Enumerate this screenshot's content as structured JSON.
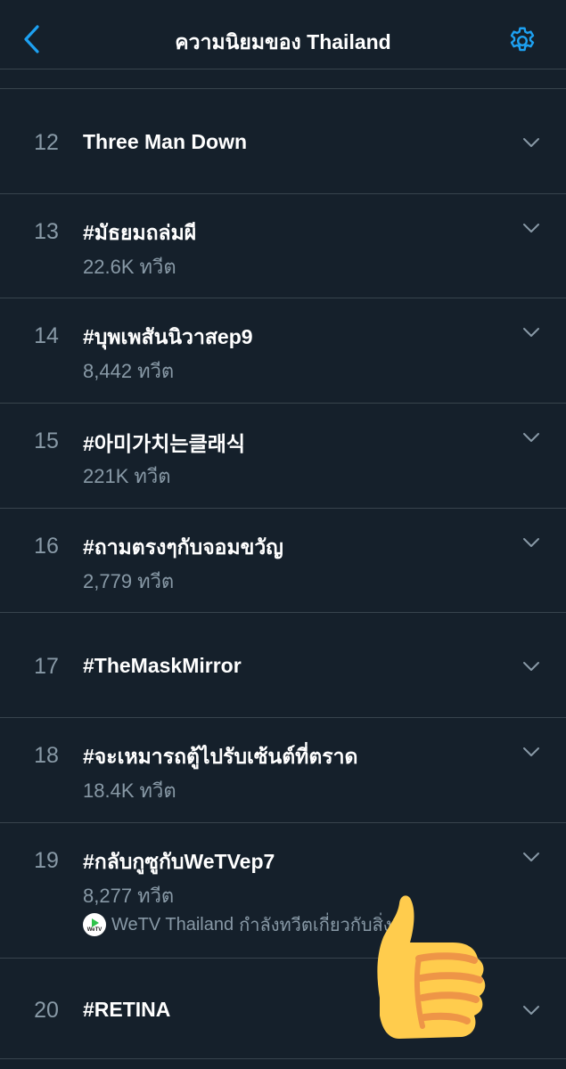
{
  "header": {
    "title": "ความนิยมของ Thailand",
    "back_icon": "chevron-left-icon",
    "settings_icon": "gear-icon",
    "accent_color": "#1da1f2"
  },
  "trends": [
    {
      "rank": "12",
      "name": "Three Man Down"
    },
    {
      "rank": "13",
      "name": "#มัธยมถล่มผี",
      "count": "22.6K",
      "count_unit": "ทวีต"
    },
    {
      "rank": "14",
      "name": "#บุพเพสันนิวาสep9",
      "count": "8,442",
      "count_unit": "ทวีต"
    },
    {
      "rank": "15",
      "name": "#아미가치는클래식",
      "count": "221K",
      "count_unit": "ทวีต"
    },
    {
      "rank": "16",
      "name": "#ถามตรงๆกับจอมขวัญ",
      "count": "2,779",
      "count_unit": "ทวีต"
    },
    {
      "rank": "17",
      "name": "#TheMaskMirror"
    },
    {
      "rank": "18",
      "name": "#จะเหมารถตู้ไปรับเซ้นต์ที่ตราด",
      "count": "18.4K",
      "count_unit": "ทวีต"
    },
    {
      "rank": "19",
      "name": "#กลับกูซูกับWeTVep7",
      "count": "8,277",
      "count_unit": "ทวีต",
      "promo": {
        "logo_text": "WeTV",
        "account": "WeTV Thailand",
        "text": "กำลังทวีตเกี่ยวกับสิ่งนี้"
      }
    },
    {
      "rank": "20",
      "name": "#RETINA"
    }
  ],
  "overlay": {
    "icon": "thumbs-up-icon"
  }
}
